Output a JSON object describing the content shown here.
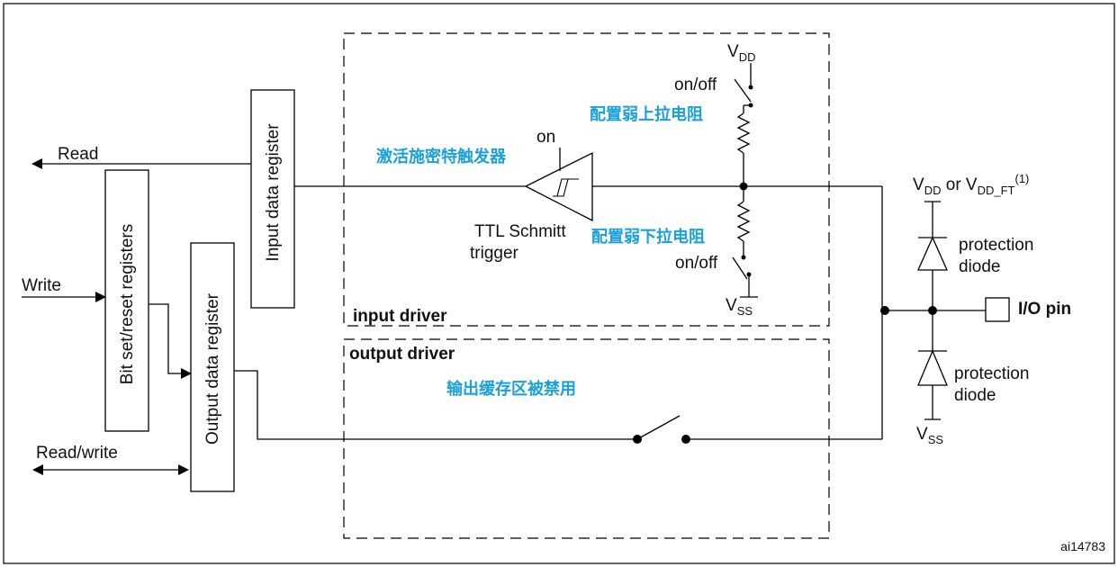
{
  "diagram": {
    "figure_id": "ai14783",
    "registers": {
      "input_data": "Input data register",
      "bit_set_reset": "Bit set/reset registers",
      "output_data": "Output data register"
    },
    "signals": {
      "read": "Read",
      "write": "Write",
      "read_write": "Read/write"
    },
    "input_driver": {
      "title": "input driver",
      "schmitt_on": "on",
      "schmitt_label_1": "TTL Schmitt",
      "schmitt_label_2": "trigger",
      "vdd_main": "V",
      "vdd_sub": "DD",
      "vss_main": "V",
      "vss_sub": "SS",
      "pullup_switch": "on/off",
      "pulldown_switch": "on/off",
      "annot_schmitt": "激活施密特触发器",
      "annot_pullup": "配置弱上拉电阻",
      "annot_pulldown": "配置弱下拉电阻"
    },
    "output_driver": {
      "title": "output driver",
      "annot_buffer": "输出缓存区被禁用"
    },
    "pin": {
      "vdd_main": "V",
      "vdd_sub": "DD",
      "or_text": " or ",
      "vddft_main": "V",
      "vddft_sub": "DD_FT",
      "vddft_sup": "(1)",
      "vss_main": "V",
      "vss_sub": "SS",
      "protection": "protection",
      "diode": "diode",
      "io_pin": "I/O pin"
    }
  }
}
